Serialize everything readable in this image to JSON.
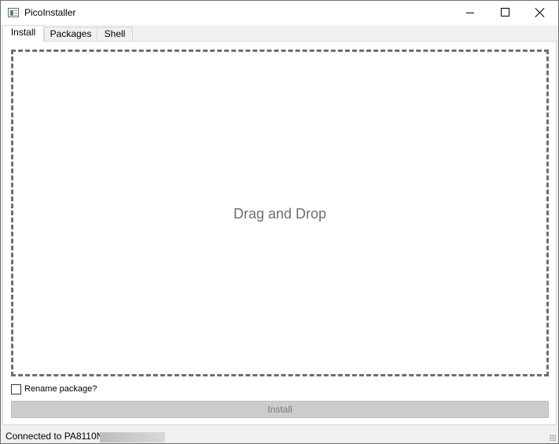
{
  "window": {
    "title": "PicoInstaller",
    "minimize_icon": "minimize-icon",
    "maximize_icon": "maximize-icon",
    "close_icon": "close-icon"
  },
  "tabs": [
    {
      "label": "Install",
      "active": true
    },
    {
      "label": "Packages",
      "active": false
    },
    {
      "label": "Shell",
      "active": false
    }
  ],
  "install_tab": {
    "dropzone_text": "Drag and Drop",
    "rename_checkbox_label": "Rename package?",
    "rename_checked": false,
    "install_button_label": "Install",
    "install_button_enabled": false
  },
  "statusbar": {
    "text": "Connected to PA8110N"
  },
  "colors": {
    "dropzone_border": "#6e6e6e",
    "disabled_button": "#cccccc",
    "background": "#f0f0f0"
  }
}
